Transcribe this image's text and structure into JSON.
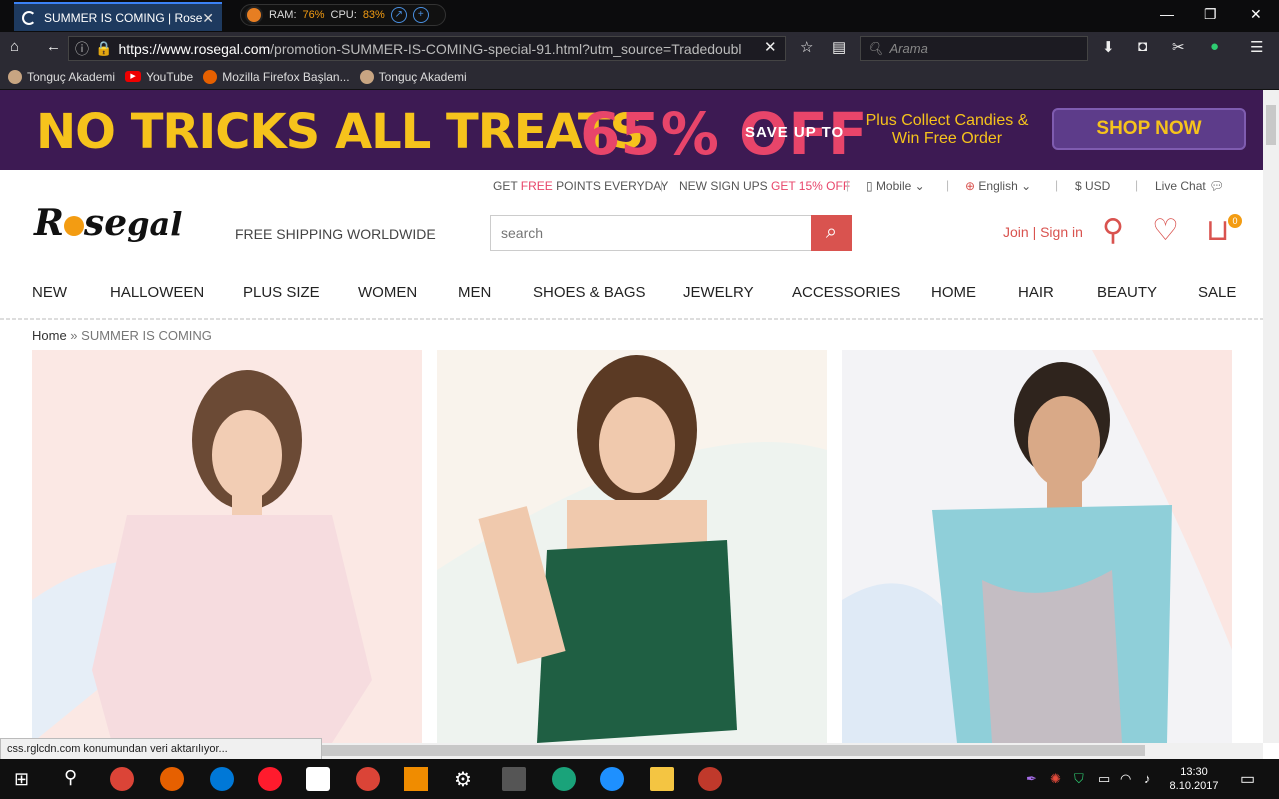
{
  "browser": {
    "tab_title": "SUMMER IS COMING | Rose",
    "tab_close": "✕",
    "monitor": {
      "ram_label": "RAM:",
      "ram_value": "76%",
      "cpu_label": "CPU:",
      "cpu_value": "83%"
    },
    "url_domain": "https://www.rosegal.com",
    "url_path": "/promotion-SUMMER-IS-COMING-special-91.html?utm_source=Tradedoubl",
    "search_placeholder": "Arama",
    "bookmarks": [
      "Tonguç Akademi",
      "YouTube",
      "Mozilla Firefox Başlan...",
      "Tonguç Akademi"
    ],
    "status_text": "css.rglcdn.com konumundan veri aktarılıyor..."
  },
  "banner": {
    "headline": "NO TRICKS ALL TREATS",
    "percent": "65% OFF",
    "save": "SAVE UP TO",
    "collect": "Plus Collect Candies & Win Free Order",
    "shop_now": "SHOP NOW"
  },
  "topbar": {
    "points_pre": "GET ",
    "points_red": "FREE",
    "points_post": " POINTS EVERYDAY",
    "signup_pre": "NEW SIGN UPS ",
    "signup_red": "GET 15% OFF",
    "mobile": "Mobile",
    "language": "English",
    "currency": "$ USD",
    "live_chat": "Live Chat"
  },
  "header": {
    "logo": "Rosegal",
    "free_shipping": "FREE SHIPPING WORLDWIDE",
    "search_placeholder": "search",
    "join_sign_in": "Join | Sign in",
    "cart_count": "0"
  },
  "nav": [
    "NEW",
    "HALLOWEEN",
    "PLUS SIZE",
    "WOMEN",
    "MEN",
    "SHOES & BAGS",
    "JEWELRY",
    "ACCESSORIES",
    "HOME",
    "HAIR",
    "BEAUTY",
    "SALE"
  ],
  "breadcrumb": {
    "home": "Home",
    "sep": " » ",
    "current": "SUMMER IS COMING"
  },
  "clock": {
    "time": "13:30",
    "date": "8.10.2017"
  }
}
